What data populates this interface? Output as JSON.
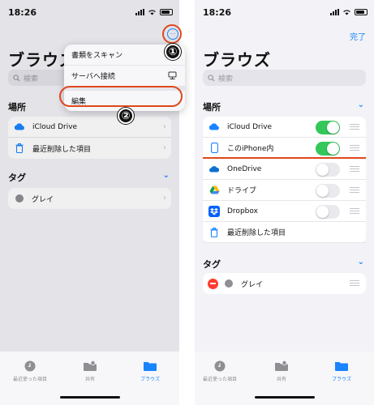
{
  "left": {
    "time": "18:26",
    "title": "ブラウズ",
    "search_placeholder": "検索",
    "more_icon_glyph": "···",
    "menu": [
      {
        "label": "書類をスキャン",
        "icon": "scan-icon"
      },
      {
        "label": "サーバへ接続",
        "icon": "server-icon"
      },
      {
        "label": "編集",
        "icon": ""
      }
    ],
    "locations_header": "場所",
    "locations": [
      {
        "label": "iCloud Drive",
        "icon": "icloud-icon"
      },
      {
        "label": "最近削除した項目",
        "icon": "trash-icon"
      }
    ],
    "tags_header": "タグ",
    "tags": [
      {
        "label": "グレイ",
        "color": "#8e8e93"
      }
    ],
    "annotations": [
      "①",
      "②"
    ]
  },
  "right": {
    "time": "18:26",
    "title": "ブラウズ",
    "done_label": "完了",
    "search_placeholder": "検索",
    "locations_header": "場所",
    "locations": [
      {
        "label": "iCloud Drive",
        "icon": "icloud-icon",
        "toggle": true
      },
      {
        "label": "このiPhone内",
        "icon": "iphone-icon",
        "toggle": true
      },
      {
        "label": "OneDrive",
        "icon": "onedrive-icon",
        "toggle": false
      },
      {
        "label": "ドライブ",
        "icon": "google-drive-icon",
        "toggle": false
      },
      {
        "label": "Dropbox",
        "icon": "dropbox-icon",
        "toggle": false
      },
      {
        "label": "最近削除した項目",
        "icon": "trash-icon",
        "toggle": null
      }
    ],
    "tags_header": "タグ",
    "tags": [
      {
        "label": "グレイ",
        "color": "#8e8e93"
      }
    ]
  },
  "tabbar": [
    {
      "label": "最近使った項目",
      "icon": "clock-icon",
      "active": false
    },
    {
      "label": "共有",
      "icon": "shared-folder-icon",
      "active": false
    },
    {
      "label": "ブラウズ",
      "icon": "folder-icon",
      "active": true
    }
  ],
  "colors": {
    "accent": "#1a84ff",
    "highlight": "#e0471c",
    "toggle_on": "#34c759"
  }
}
